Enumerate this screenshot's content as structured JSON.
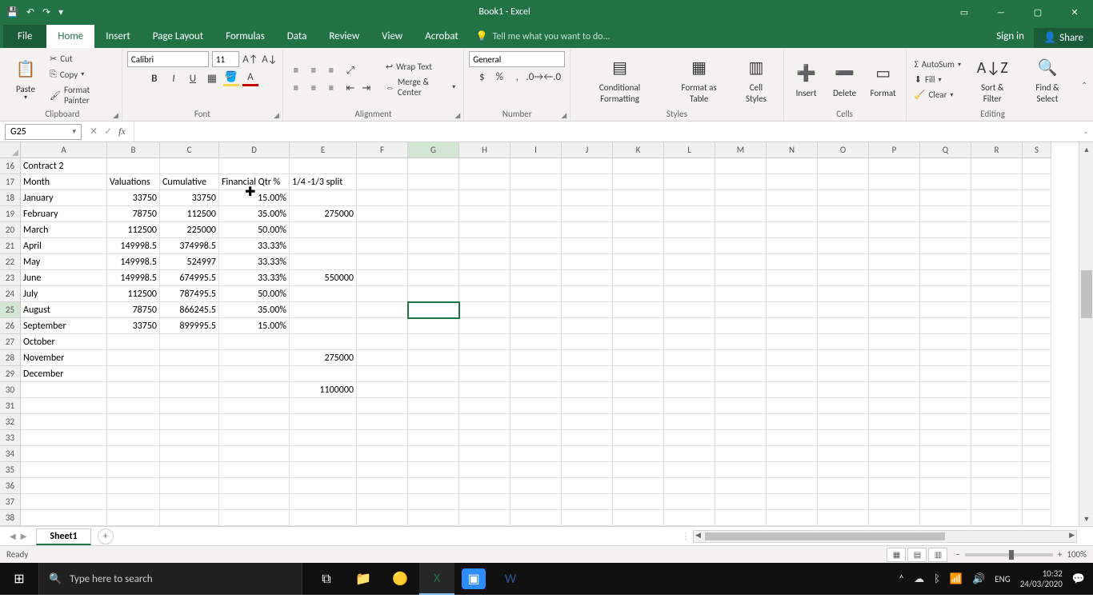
{
  "title": "Book1 - Excel",
  "qat": {
    "save": "💾",
    "undo": "↶",
    "redo": "↷"
  },
  "win": {
    "opts": "▭",
    "min": "—",
    "max": "▢",
    "close": "✕"
  },
  "tabs": {
    "file": "File",
    "home": "Home",
    "insert": "Insert",
    "pagelayout": "Page Layout",
    "formulas": "Formulas",
    "data": "Data",
    "review": "Review",
    "view": "View",
    "acrobat": "Acrobat",
    "tellme": "Tell me what you want to do...",
    "signin": "Sign in",
    "share": "Share"
  },
  "ribbon": {
    "clipboard": {
      "label": "Clipboard",
      "paste": "Paste",
      "cut": "Cut",
      "copy": "Copy",
      "painter": "Format Painter"
    },
    "font": {
      "label": "Font",
      "name": "Calibri",
      "size": "11"
    },
    "alignment": {
      "label": "Alignment",
      "wrap": "Wrap Text",
      "merge": "Merge & Center"
    },
    "number": {
      "label": "Number",
      "format": "General"
    },
    "styles": {
      "label": "Styles",
      "cond": "Conditional Formatting",
      "table": "Format as Table",
      "cell": "Cell Styles"
    },
    "cells": {
      "label": "Cells",
      "insert": "Insert",
      "delete": "Delete",
      "format": "Format"
    },
    "editing": {
      "label": "Editing",
      "autosum": "AutoSum",
      "fill": "Fill",
      "clear": "Clear",
      "sort": "Sort & Filter",
      "find": "Find & Select"
    }
  },
  "namebox": "G25",
  "formula": "",
  "columns": [
    "A",
    "B",
    "C",
    "D",
    "E",
    "F",
    "G",
    "H",
    "I",
    "J",
    "K",
    "L",
    "M",
    "N",
    "O",
    "P",
    "Q",
    "R",
    "S"
  ],
  "selected_col": "G",
  "selected_row": 25,
  "first_row": 16,
  "row_count": 23,
  "rows": [
    {
      "n": 16,
      "A": "Contract 2"
    },
    {
      "n": 17,
      "A": "Month",
      "B": "Valuations",
      "C": "Cumulative",
      "D": "Financial Qtr %",
      "E": "1/4 -1/3 split"
    },
    {
      "n": 18,
      "A": "January",
      "B": "33750",
      "C": "33750",
      "D": "15.00%"
    },
    {
      "n": 19,
      "A": "February",
      "B": "78750",
      "C": "112500",
      "D": "35.00%",
      "E": "275000"
    },
    {
      "n": 20,
      "A": "March",
      "B": "112500",
      "C": "225000",
      "D": "50.00%"
    },
    {
      "n": 21,
      "A": "April",
      "B": "149998.5",
      "C": "374998.5",
      "D": "33.33%"
    },
    {
      "n": 22,
      "A": "May",
      "B": "149998.5",
      "C": "524997",
      "D": "33.33%"
    },
    {
      "n": 23,
      "A": "June",
      "B": "149998.5",
      "C": "674995.5",
      "D": "33.33%",
      "E": "550000"
    },
    {
      "n": 24,
      "A": "July",
      "B": "112500",
      "C": "787495.5",
      "D": "50.00%"
    },
    {
      "n": 25,
      "A": "August",
      "B": "78750",
      "C": "866245.5",
      "D": "35.00%"
    },
    {
      "n": 26,
      "A": "September",
      "B": "33750",
      "C": "899995.5",
      "D": "15.00%"
    },
    {
      "n": 27,
      "A": "October"
    },
    {
      "n": 28,
      "A": "November",
      "E": "275000"
    },
    {
      "n": 29,
      "A": "December"
    },
    {
      "n": 30,
      "E": "1100000"
    },
    {
      "n": 31
    },
    {
      "n": 32
    },
    {
      "n": 33
    },
    {
      "n": 34
    },
    {
      "n": 35
    },
    {
      "n": 36
    },
    {
      "n": 37
    },
    {
      "n": 38
    }
  ],
  "sheet": {
    "name": "Sheet1"
  },
  "status": {
    "ready": "Ready",
    "zoom": "100%"
  },
  "taskbar": {
    "search_placeholder": "Type here to search",
    "lang": "ENG",
    "time": "10:32",
    "date": "24/03/2020"
  }
}
